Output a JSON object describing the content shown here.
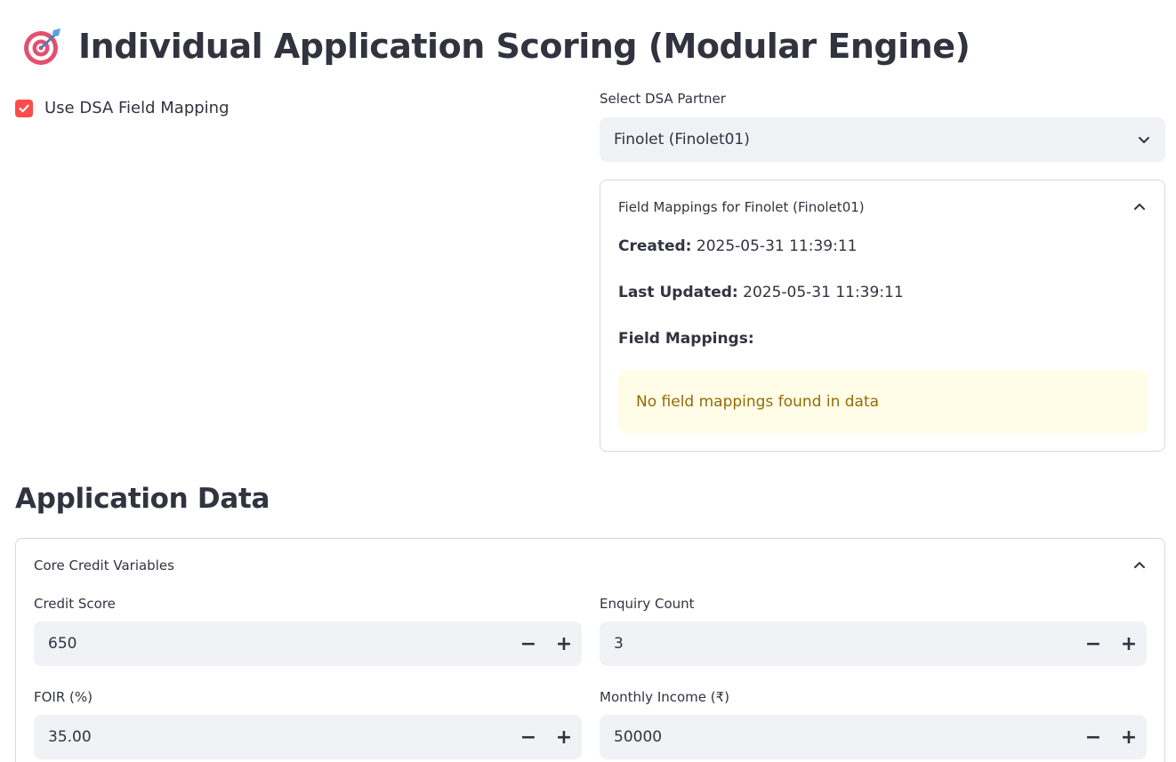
{
  "header": {
    "title": "Individual Application Scoring (Modular Engine)",
    "icon": "target-icon"
  },
  "dsa_mapping": {
    "checkbox_label": "Use DSA Field Mapping",
    "checked": true
  },
  "partner_select": {
    "label": "Select DSA Partner",
    "value": "Finolet (Finolet01)"
  },
  "mapping_expander": {
    "title": "Field Mappings for Finolet (Finolet01)",
    "expanded": true,
    "created_label": "Created:",
    "created_value": "2025-05-31 11:39:11",
    "updated_label": "Last Updated:",
    "updated_value": "2025-05-31 11:39:11",
    "mappings_label": "Field Mappings:",
    "alert_text": "No field mappings found in data"
  },
  "application_data": {
    "title": "Application Data",
    "core_expander": {
      "title": "Core Credit Variables",
      "expanded": true,
      "fields": [
        {
          "label": "Credit Score",
          "value": "650"
        },
        {
          "label": "Enquiry Count",
          "value": "3"
        },
        {
          "label": "FOIR (%)",
          "value": "35.00"
        },
        {
          "label": "Monthly Income (₹)",
          "value": "50000"
        }
      ]
    }
  },
  "stepper": {
    "minus": "−",
    "plus": "+"
  },
  "colors": {
    "accent": "#ff4b4b",
    "input_bg": "#f0f2f6",
    "alert_bg": "#fffce7",
    "alert_text": "#926c05",
    "text": "#31333f"
  }
}
